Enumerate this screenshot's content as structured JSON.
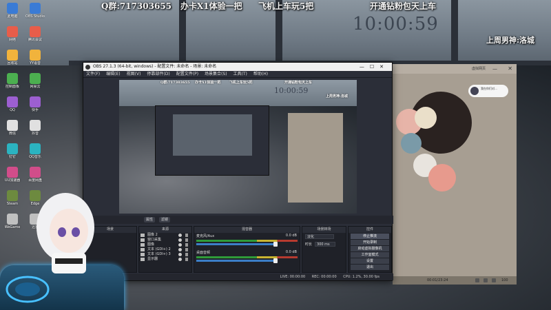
{
  "stream_overlay": {
    "qq_group": "Q群:717303655",
    "promo_1": "办卡X1体验一把",
    "promo_2": "飞机上车玩5把",
    "promo_3": "开通钻粉包天上车",
    "clock": "10:00:59",
    "weekly_top": "上周男神:洛城"
  },
  "obs": {
    "title": "OBS 27.1.3 (64-bit, windows) - 配置文件: 未命名 - 场景: 未命名",
    "menu": [
      "文件(F)",
      "编辑(E)",
      "视图(V)",
      "停靠部件(D)",
      "配置文件(P)",
      "场景集合(S)",
      "工具(T)",
      "帮助(H)"
    ],
    "preview_toolbar": [
      "属性",
      "滤镜"
    ],
    "docks": {
      "scenes": "场景",
      "sources": "来源",
      "mixer": "混音器",
      "transitions": "场景转场",
      "controls": "控件"
    },
    "sources": [
      "图像 2",
      "窗口采集",
      "图像",
      "文本 (GDI+) 2",
      "文本 (GDI+) 3",
      "显示器"
    ],
    "mixer": [
      {
        "name": "麦克风/Aux",
        "db": "0.0 dB"
      },
      {
        "name": "桌面音频",
        "db": "0.0 dB"
      }
    ],
    "transitions": {
      "type_label": "淡化",
      "duration_label": "时长",
      "duration_value": "300 ms"
    },
    "controls": [
      "停止推流",
      "开始录制",
      "启动虚拟摄像机",
      "工作室模式",
      "设置",
      "退出"
    ],
    "status": {
      "live": "LIVE: 00:00:00",
      "rec": "REC: 00:00:00",
      "cpu": "CPU: 1.2%, 30.00 fps"
    }
  },
  "right_panel": {
    "header": "虚拟网页",
    "chat_text": "我在你们对…",
    "footer_time": "00:01/23:24",
    "footer_count": "100"
  },
  "desktop_icons": [
    "此电脑",
    "网络",
    "回收站",
    "控制面板",
    "QQ",
    "微信",
    "钉钉",
    "UU加速器",
    "Steam",
    "WeGame",
    "OBS Studio",
    "腾讯会议",
    "YY语音",
    "网易云",
    "快手",
    "抖音",
    "QQ音乐",
    "百度网盘",
    "Edge",
    "迅雷"
  ],
  "colors": {
    "obs_bg": "#2b2e38",
    "dock_bg": "#1f2128",
    "meter_green": "#2f9b3a",
    "meter_yellow": "#c8b431",
    "meter_red": "#b63a2f",
    "slider_blue": "#3c7fc8",
    "panel_beige": "#a79e92"
  }
}
